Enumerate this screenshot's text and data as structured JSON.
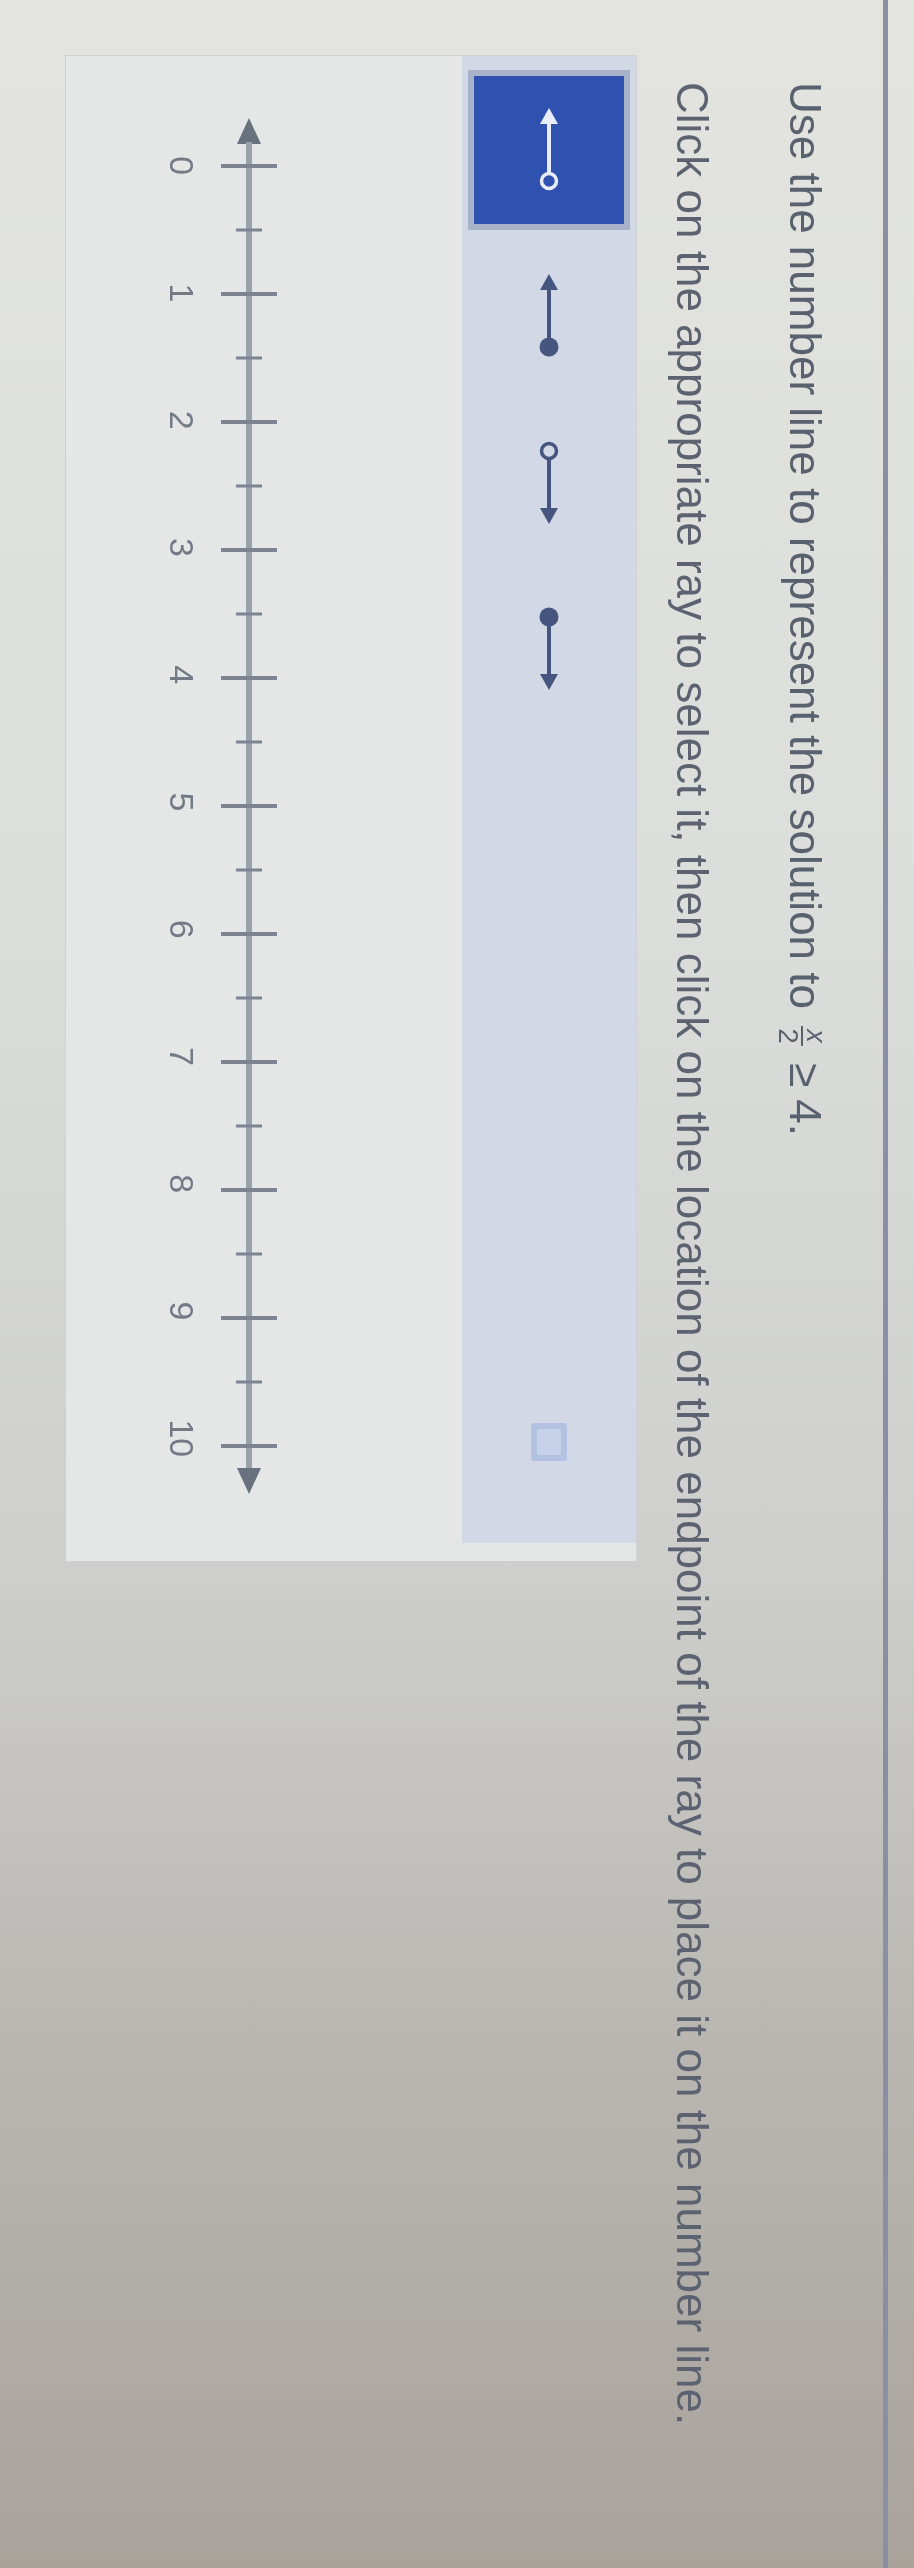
{
  "question": {
    "text_before": "Use the number line to represent the solution to",
    "numerator": "x",
    "denominator": "2",
    "text_after": "≥ 4."
  },
  "instruction": "Click on the appropriate ray to select it, then click on the location of the endpoint of the ray to place it on the number line.",
  "tools": [
    {
      "kind": "ray-left-open",
      "selected": true
    },
    {
      "kind": "ray-left-closed",
      "selected": false
    },
    {
      "kind": "ray-right-open",
      "selected": false
    },
    {
      "kind": "ray-right-closed",
      "selected": false
    }
  ],
  "number_line": {
    "labels": [
      "0",
      "1",
      "2",
      "3",
      "4",
      "5",
      "6",
      "7",
      "8",
      "9",
      "10"
    ]
  }
}
